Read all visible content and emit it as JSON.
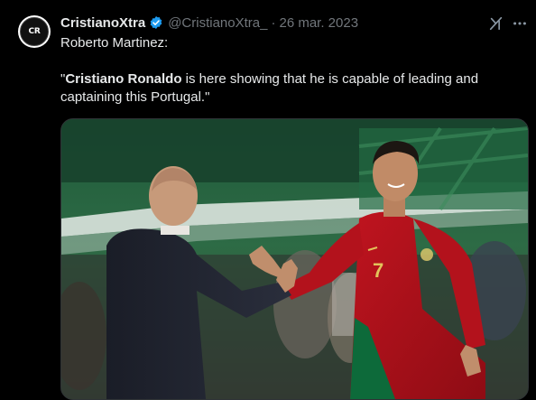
{
  "author": {
    "display_name": "CristianoXtra",
    "handle": "@CristianoXtra_",
    "separator": "·",
    "date": "26 mar. 2023",
    "verified": true,
    "avatar_label": "CR",
    "verified_color": "#1d9bf0"
  },
  "tweet": {
    "line1": "Roberto Martinez:",
    "quote_open": "\"",
    "quote_bold": "Cristiano Ronaldo",
    "quote_rest": " is here showing that he is capable of leading and captaining this Portugal.\""
  },
  "icons": {
    "grok": "grok-icon",
    "more": "more-horizontal-icon",
    "verified": "verified-badge-icon"
  },
  "colors": {
    "background": "#000000",
    "text": "#e7e9ea",
    "muted": "#71767b",
    "jersey_red": "#b5121b",
    "jersey_green": "#0a6b3b"
  },
  "media": {
    "jersey_number": "7"
  }
}
